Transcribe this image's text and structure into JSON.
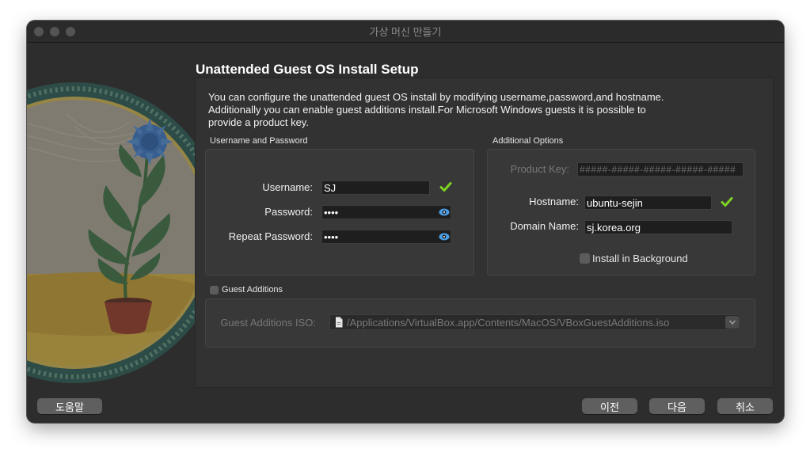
{
  "window": {
    "title": "가상 머신 만들기"
  },
  "page": {
    "title": "Unattended Guest OS Install Setup",
    "description": "You can configure the unattended guest OS install by modifying username,password,and hostname.\nAdditionally you can enable guest additions install.For Microsoft Windows guests it is possible to\nprovide a product key."
  },
  "credentials": {
    "group_label": "Username and Password",
    "username_label": "Username:",
    "username_value": "SJ",
    "password_label": "Password:",
    "password_value": "••••",
    "repeat_password_label": "Repeat Password:",
    "repeat_password_value": "••••"
  },
  "options": {
    "group_label": "Additional Options",
    "product_key_label": "Product Key:",
    "product_key_placeholder": "#####-#####-#####-#####-#####",
    "hostname_label": "Hostname:",
    "hostname_value": "ubuntu-sejin",
    "domain_label": "Domain Name:",
    "domain_value": "sj.korea.org",
    "install_background_label": "Install in Background",
    "install_background_checked": false
  },
  "guest_additions": {
    "label": "Guest Additions",
    "checked": false,
    "iso_label": "Guest Additions ISO:",
    "iso_path": "/Applications/VirtualBox.app/Contents/MacOS/VBoxGuestAdditions.iso"
  },
  "buttons": {
    "help": "도움말",
    "back": "이전",
    "next": "다음",
    "cancel": "취소"
  },
  "colors": {
    "valid_check": "#7ed321",
    "eye_icon": "#4a9fe8"
  },
  "icons": [
    "check-icon",
    "eye-icon",
    "file-icon",
    "chevron-down-icon"
  ]
}
